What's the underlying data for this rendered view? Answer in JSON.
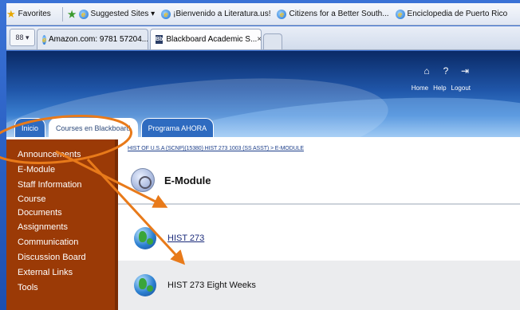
{
  "browser": {
    "favorites_label": "Favorites",
    "bookmarks": [
      {
        "label": "Suggested Sites ▾"
      },
      {
        "label": "¡Bienvenido a Literatura.us!"
      },
      {
        "label": "Citizens for a Better South..."
      },
      {
        "label": "Enciclopedia de Puerto Rico"
      }
    ],
    "quicktab_label": "88 ▾",
    "tabs": [
      {
        "label": "Amazon.com: 9781 57204..."
      },
      {
        "label": "Blackboard Academic S...",
        "close": "×"
      }
    ]
  },
  "header": {
    "top_icons": [
      {
        "name": "home-icon",
        "glyph": "⌂"
      },
      {
        "name": "help-icon",
        "glyph": "?"
      },
      {
        "name": "logout-icon",
        "glyph": "⇥"
      }
    ],
    "top_links": {
      "home": "Home",
      "help": "Help",
      "logout": "Logout"
    },
    "tabs": [
      {
        "label": "Inicio"
      },
      {
        "label": "Courses en Blackboard"
      },
      {
        "label": "Programa AHORA"
      }
    ]
  },
  "menu": {
    "items": [
      "Announcements",
      "E-Module",
      "Staff Information",
      "Course Documents",
      "Assignments",
      "Communication",
      "Discussion Board",
      "External Links",
      "Tools"
    ]
  },
  "content": {
    "breadcrumb": "HIST OF U.S.A (SCNP)(15380) HIST 273 1003 (SS ASST) > E-MODULE",
    "title": "E-Module",
    "rows": [
      {
        "label": "HIST 273"
      },
      {
        "label": "HIST 273 Eight Weeks"
      }
    ]
  },
  "annotation": {
    "color": "#e87a1a"
  }
}
